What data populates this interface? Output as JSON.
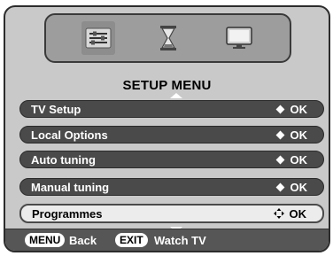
{
  "tabs": [
    {
      "icon": "settings-sliders-icon",
      "active": true
    },
    {
      "icon": "hourglass-icon",
      "active": false
    },
    {
      "icon": "monitor-icon",
      "active": false
    }
  ],
  "title": "SETUP MENU",
  "items": [
    {
      "label": "TV Setup",
      "ok": "OK"
    },
    {
      "label": "Local Options",
      "ok": "OK"
    },
    {
      "label": "Auto tuning",
      "ok": "OK"
    },
    {
      "label": "Manual tuning",
      "ok": "OK"
    },
    {
      "label": "Programmes",
      "ok": "OK"
    }
  ],
  "footer": {
    "menu_key": "MENU",
    "back_label": "Back",
    "exit_key": "EXIT",
    "watch_label": "Watch TV"
  },
  "colors": {
    "panel_bg": "#c9c9c9",
    "item_bg": "#4a4a4a",
    "selected_bg": "#ececec",
    "footer_bg": "#565656"
  }
}
